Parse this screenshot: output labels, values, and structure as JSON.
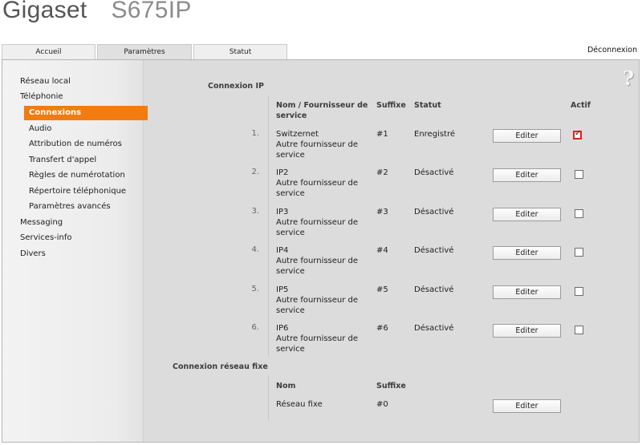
{
  "brand": {
    "name": "Gigaset",
    "model": "S675IP"
  },
  "tabs": [
    {
      "label": "Accueil",
      "active": false
    },
    {
      "label": "Paramètres",
      "active": true
    },
    {
      "label": "Statut",
      "active": false
    }
  ],
  "logout_label": "Déconnexion",
  "help_label": "?",
  "sidebar": {
    "items": [
      {
        "label": "Réseau local",
        "level": 1,
        "active": false
      },
      {
        "label": "Téléphonie",
        "level": 1,
        "active": false
      },
      {
        "label": "Connexions",
        "level": 2,
        "active": true
      },
      {
        "label": "Audio",
        "level": 2,
        "active": false
      },
      {
        "label": "Attribution de numéros",
        "level": 2,
        "active": false
      },
      {
        "label": "Transfert d'appel",
        "level": 2,
        "active": false
      },
      {
        "label": "Règles de numérotation",
        "level": 2,
        "active": false
      },
      {
        "label": "Répertoire téléphonique",
        "level": 2,
        "active": false
      },
      {
        "label": "Paramètres avancés",
        "level": 2,
        "active": false
      },
      {
        "label": "Messaging",
        "level": 1,
        "active": false
      },
      {
        "label": "Services-info",
        "level": 1,
        "active": false
      },
      {
        "label": "Divers",
        "level": 1,
        "active": false
      }
    ]
  },
  "ip_section": {
    "title": "Connexion IP",
    "headers": {
      "name": "Nom / Fournisseur de service",
      "suffix": "Suffixe",
      "status": "Statut",
      "active": "Actif"
    },
    "rows": [
      {
        "index": "1.",
        "name": "Switzernet",
        "provider": "Autre fournisseur de service",
        "suffix": "#1",
        "status": "Enregistré",
        "button": "Editer",
        "active": true
      },
      {
        "index": "2.",
        "name": "IP2",
        "provider": "Autre fournisseur de service",
        "suffix": "#2",
        "status": "Désactivé",
        "button": "Editer",
        "active": false
      },
      {
        "index": "3.",
        "name": "IP3",
        "provider": "Autre fournisseur de service",
        "suffix": "#3",
        "status": "Désactivé",
        "button": "Editer",
        "active": false
      },
      {
        "index": "4.",
        "name": "IP4",
        "provider": "Autre fournisseur de service",
        "suffix": "#4",
        "status": "Désactivé",
        "button": "Editer",
        "active": false
      },
      {
        "index": "5.",
        "name": "IP5",
        "provider": "Autre fournisseur de service",
        "suffix": "#5",
        "status": "Désactivé",
        "button": "Editer",
        "active": false
      },
      {
        "index": "6.",
        "name": "IP6",
        "provider": "Autre fournisseur de service",
        "suffix": "#6",
        "status": "Désactivé",
        "button": "Editer",
        "active": false
      }
    ]
  },
  "fixed_section": {
    "title": "Connexion réseau fixe",
    "headers": {
      "name": "Nom",
      "suffix": "Suffixe"
    },
    "row": {
      "name": "Réseau fixe",
      "suffix": "#0",
      "button": "Editer"
    }
  },
  "colors": {
    "accent": "#f07c12",
    "active_check_border": "#d8241e"
  }
}
